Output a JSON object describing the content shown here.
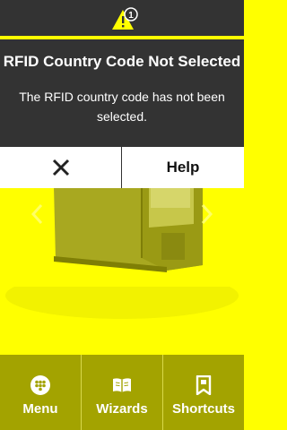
{
  "status_bar": {
    "alert_icon": "warning-icon",
    "alert_count": "1"
  },
  "alert": {
    "title": "RFID Country Code Not Selected",
    "message": "The RFID country code has not been selected."
  },
  "actions": {
    "close_icon": "close-icon",
    "help_label": "Help"
  },
  "home": {
    "image": "printer-image",
    "prev_icon": "chevron-left-icon",
    "next_icon": "chevron-right-icon"
  },
  "nav": {
    "menu_label": "Menu",
    "wizards_label": "Wizards",
    "shortcuts_label": "Shortcuts"
  },
  "colors": {
    "accent_yellow": "#ffff00",
    "dark": "#333333",
    "nav_olive": "#a3a300"
  }
}
